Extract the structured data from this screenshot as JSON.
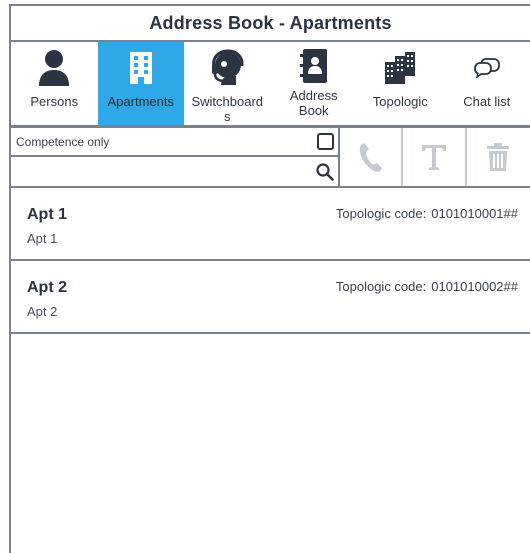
{
  "window": {
    "title": "Address Book - Apartments"
  },
  "tabs": [
    {
      "label": "Persons",
      "icon": "person-icon",
      "active": false
    },
    {
      "label": "Apartments",
      "icon": "building-icon",
      "active": true
    },
    {
      "label": "Switchboard\ns",
      "icon": "headset-icon",
      "active": false
    },
    {
      "label": "Address\nBook",
      "icon": "address-book-icon",
      "active": false
    },
    {
      "label": "Topologic",
      "icon": "buildings-icon",
      "active": false
    },
    {
      "label": "Chat list",
      "icon": "chat-icon",
      "active": false
    }
  ],
  "filters": {
    "competence_label": "Competence only",
    "competence_checked": false,
    "search_value": "",
    "search_icon": "search-icon"
  },
  "toolbar": {
    "call_icon": "phone-icon",
    "text_icon": "text-icon",
    "delete_icon": "trash-icon"
  },
  "apartments": [
    {
      "name": "Apt 1",
      "description": "Apt 1",
      "code_label": "Topologic code:",
      "code": "0101010001##"
    },
    {
      "name": "Apt 2",
      "description": "Apt 2",
      "code_label": "Topologic code:",
      "code": "0101010002##"
    }
  ],
  "colors": {
    "accent": "#2ea8e6",
    "border": "#7a8290",
    "text": "#2a3443",
    "disabled_icon": "#c5cad2"
  }
}
